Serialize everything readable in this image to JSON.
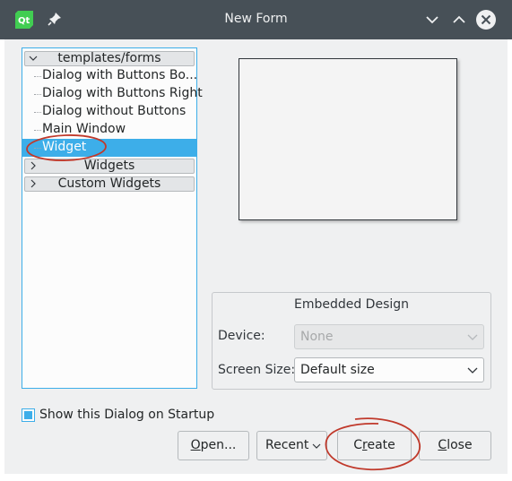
{
  "window": {
    "title": "New Form"
  },
  "tree": {
    "root_label": "templates/forms",
    "items": [
      {
        "label": "Dialog with Buttons Bo..."
      },
      {
        "label": "Dialog with Buttons Right"
      },
      {
        "label": "Dialog without Buttons"
      },
      {
        "label": "Main Window"
      },
      {
        "label": "Widget"
      }
    ],
    "collapsed": [
      {
        "label": "Widgets"
      },
      {
        "label": "Custom Widgets"
      }
    ]
  },
  "embedded": {
    "title": "Embedded Design",
    "device_label": "Device:",
    "device_value": "None",
    "screen_label": "Screen Size:",
    "screen_value": "Default size"
  },
  "startup": {
    "label": "Show this Dialog on Startup",
    "checked": true
  },
  "buttons": {
    "open_pre": "",
    "open_ul": "O",
    "open_post": "pen...",
    "recent": "Recent",
    "create_pre": "C",
    "create_ul": "r",
    "create_post": "eate",
    "close_pre": "",
    "close_ul": "C",
    "close_post": "lose"
  },
  "colors": {
    "titlebar": "#475057",
    "selection": "#3daee9",
    "annotation": "#c0392b",
    "qt_green": "#41cd52"
  },
  "icons": [
    "qt-logo-icon",
    "pin-icon",
    "minimize-icon",
    "maximize-icon",
    "close-icon",
    "chevron-down-icon",
    "chevron-right-icon"
  ]
}
